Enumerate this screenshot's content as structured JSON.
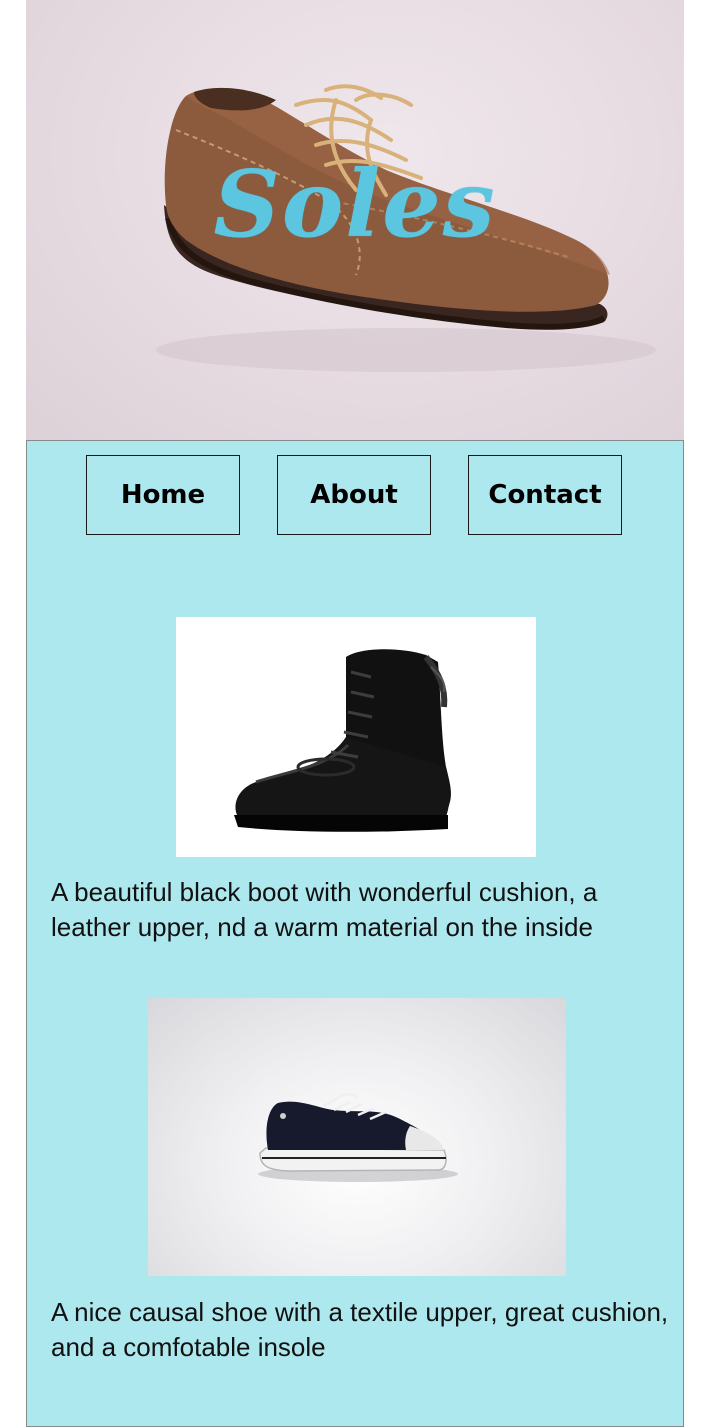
{
  "hero": {
    "brand": "Soles",
    "image": "brown-suede-oxford-shoe"
  },
  "nav": {
    "items": [
      {
        "label": "Home"
      },
      {
        "label": "About"
      },
      {
        "label": "Contact"
      }
    ]
  },
  "products": [
    {
      "image": "black-leather-boot",
      "description": "A beautiful black boot with wonderful cushion, a leather upper, nd a warm material on the inside"
    },
    {
      "image": "black-canvas-sneaker",
      "description": "A nice causal shoe with a textile upper, great cushion, and a comfotable insole"
    }
  ],
  "colors": {
    "content_bg": "#aee8ef",
    "brand": "#5cc6e0",
    "nav_border": "#1a1a1a"
  }
}
